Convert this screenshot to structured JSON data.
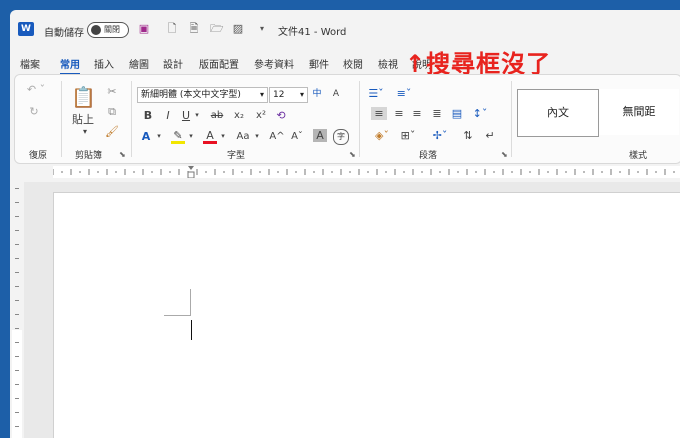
{
  "titlebar": {
    "app_icon": "word-logo-icon",
    "app_letter": "W",
    "autosave_label": "自動儲存",
    "autosave_state": "關閉",
    "document_title": "文件41 - Word"
  },
  "tabs": [
    "檔案",
    "常用",
    "插入",
    "繪圖",
    "設計",
    "版面配置",
    "參考資料",
    "郵件",
    "校閱",
    "檢視",
    "說明"
  ],
  "active_tab": "常用",
  "annotation": "↑搜尋框沒了",
  "ribbon": {
    "groups": {
      "undo": "復原",
      "clipboard": "剪貼簿",
      "font": "字型",
      "paragraph": "段落",
      "styles": "樣式"
    },
    "paste_label": "貼上",
    "font_name": "新細明體 (本文中文字型)",
    "font_size": "12",
    "styles": [
      "內文",
      "無間距"
    ],
    "buttons": {
      "bold": "B",
      "italic": "I",
      "underline": "U",
      "strike": "ab",
      "subscript": "x₂",
      "superscript": "x²",
      "change_case": "Aa",
      "grow": "A^",
      "shrink": "Aˇ",
      "char_shade": "A",
      "enclose": "字"
    }
  },
  "colors": {
    "accent": "#185abd",
    "annotation": "#e8231e",
    "desktop": "#1d5fa8"
  }
}
